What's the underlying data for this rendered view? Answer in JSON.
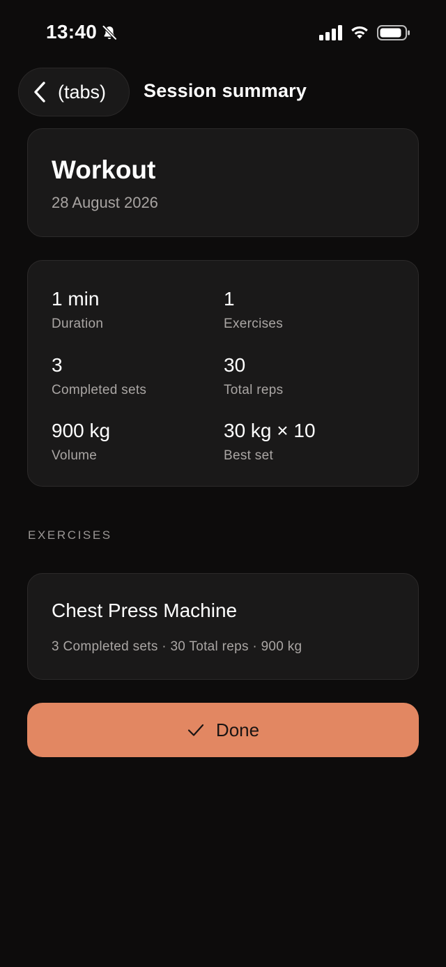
{
  "status_bar": {
    "time": "13:40",
    "icons": [
      "bell-off-icon",
      "signal-icon",
      "wifi-icon",
      "battery-icon"
    ]
  },
  "nav": {
    "back_label": "(tabs)",
    "title": "Session summary"
  },
  "workout": {
    "title": "Workout",
    "date": "28 August 2026"
  },
  "stats": [
    {
      "value": "1 min",
      "label": "Duration"
    },
    {
      "value": "1",
      "label": "Exercises"
    },
    {
      "value": "3",
      "label": "Completed sets"
    },
    {
      "value": "30",
      "label": "Total reps"
    },
    {
      "value": "900 kg",
      "label": "Volume"
    },
    {
      "value": "30 kg × 10",
      "label": "Best set"
    }
  ],
  "exercises_section": {
    "heading": "EXERCISES",
    "items": [
      {
        "name": "Chest Press Machine",
        "summary": "3 Completed sets · 30 Total reps · 900 kg"
      }
    ]
  },
  "done_button": {
    "label": "Done",
    "icon": "check-icon"
  },
  "colors": {
    "background": "#0d0c0c",
    "card": "#1a1919",
    "accent": "#e28762",
    "muted_text": "#aaa6a4"
  }
}
